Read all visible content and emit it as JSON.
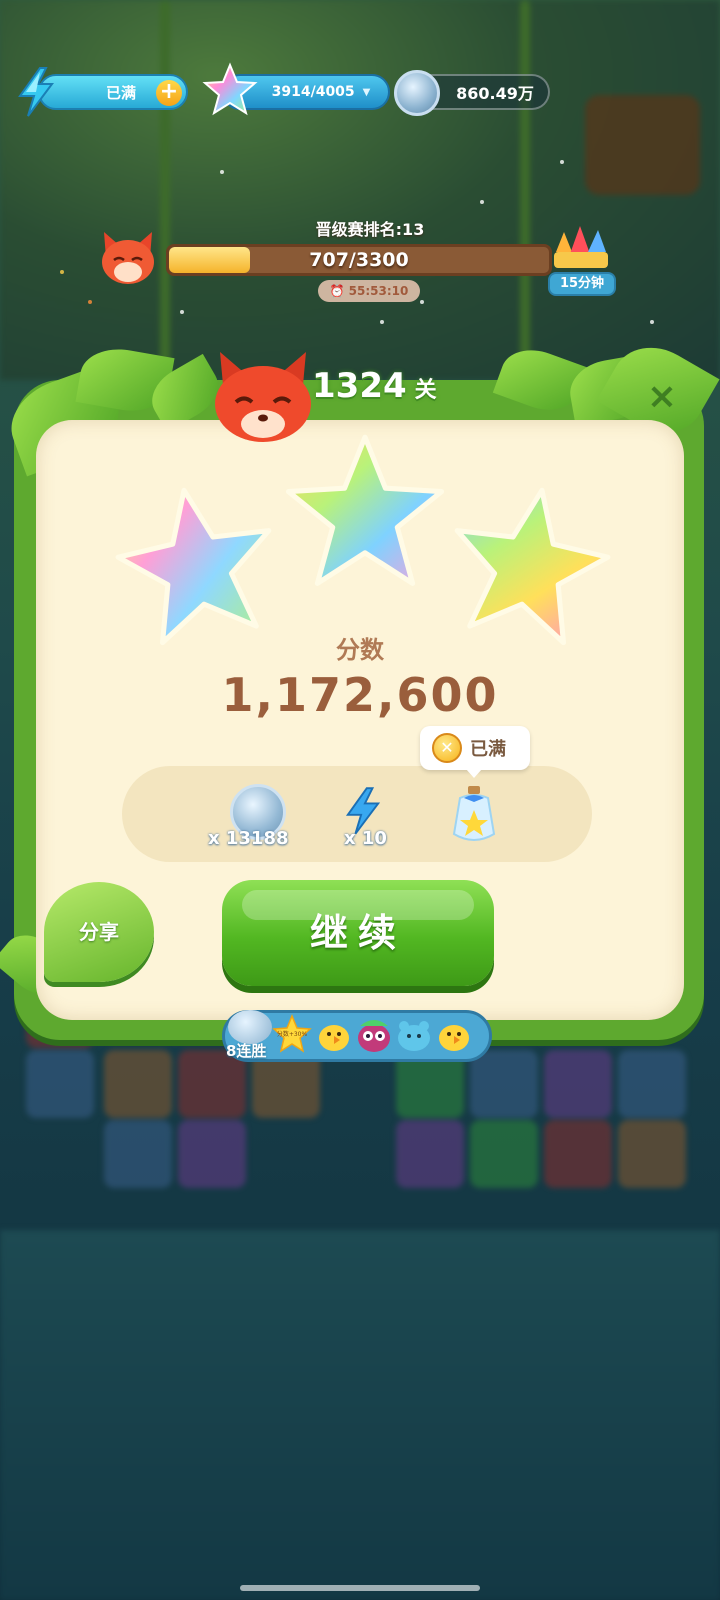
{
  "hud": {
    "energy_status": "已满",
    "energy_plus": "+",
    "stars_progress": "3914/4005",
    "stars_dropdown": "▼",
    "coins": "860.49万"
  },
  "ranking": {
    "title": "晋级赛排名:13",
    "progress_text": "707/3300",
    "progress_value": 707,
    "progress_max": 3300,
    "timer": "55:53:10",
    "gem_label": "15分钟"
  },
  "dialog": {
    "level_number": "1324",
    "level_suffix": "关",
    "close": "×",
    "stars_earned": 3,
    "score_label": "分数",
    "score_value": "1,172,600",
    "full_tag": "已满",
    "rewards": [
      {
        "icon": "silver-coin-icon",
        "count": "x 13188"
      },
      {
        "icon": "energy-bolt-icon",
        "count": "x 10"
      },
      {
        "icon": "star-jar-icon",
        "count": ""
      }
    ],
    "share_label": "分享",
    "continue_label": "继续",
    "streak_label": "8连胜",
    "streak_items": [
      "score-bonus-star-icon",
      "chick-icon",
      "owl-icon",
      "blue-monster-icon",
      "chick-icon"
    ],
    "streak_bonus_text": "分数+30%"
  },
  "colors": {
    "dialog_green": "#5ea92f",
    "panel_cream": "#fdf4d8",
    "score_brown": "#9a5e3c",
    "continue_green": "#52b722"
  }
}
